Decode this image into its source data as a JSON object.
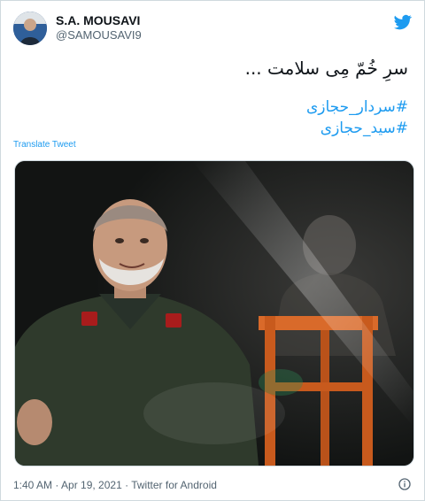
{
  "user": {
    "display_name": "S.A. MOUSAVI",
    "handle": "@SAMOUSAVI9"
  },
  "tweet": {
    "text": "سرِ خُمّ مِی سلامت ...",
    "hashtags": [
      "#سردار_حجازی",
      "#سید_حجازی"
    ],
    "translate_label": "Translate Tweet"
  },
  "meta": {
    "timestamp": "1:40 AM · Apr 19, 2021 · Twitter for Android"
  },
  "colors": {
    "link": "#1d9bf0",
    "secondary_text": "#536471",
    "border": "#cfd9de"
  },
  "icons": {
    "brand": "twitter-bird-icon",
    "info": "info-icon"
  }
}
